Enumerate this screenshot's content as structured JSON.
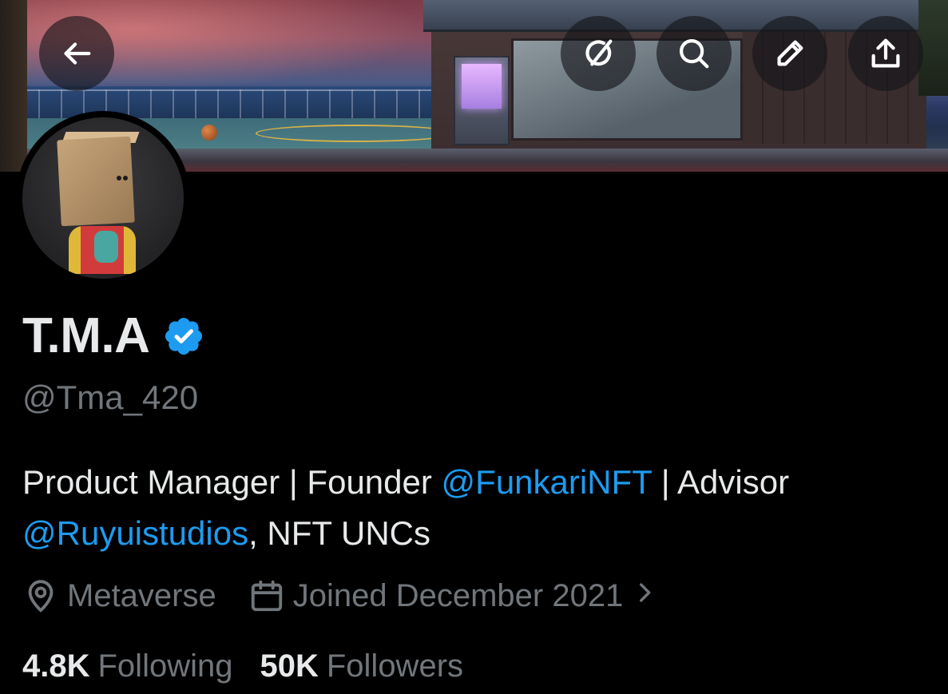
{
  "header": {
    "back_icon": "arrow-left-icon",
    "grok_icon": "grok-icon",
    "search_icon": "search-icon",
    "edit_icon": "pencil-icon",
    "share_icon": "share-upload-icon"
  },
  "profile": {
    "display_name": "T.M.A",
    "verified": true,
    "verified_color": "#1d9bf0",
    "handle": "@Tma_420",
    "bio": {
      "line1_text_a": "Product Manager | Founder ",
      "line1_mention": "@FunkariNFT",
      "line1_text_b": " | Advisor",
      "line2_mention": "@Ruyuistudios",
      "line2_text": ", NFT UNCs"
    },
    "location": "Metaverse",
    "joined": "Joined December 2021",
    "stats": {
      "following_count": "4.8K",
      "following_label": "Following",
      "followers_count": "50K",
      "followers_label": "Followers"
    }
  },
  "colors": {
    "background": "#000000",
    "primary_text": "#e7e9ea",
    "secondary_text": "#71767b",
    "link": "#1d9bf0"
  }
}
